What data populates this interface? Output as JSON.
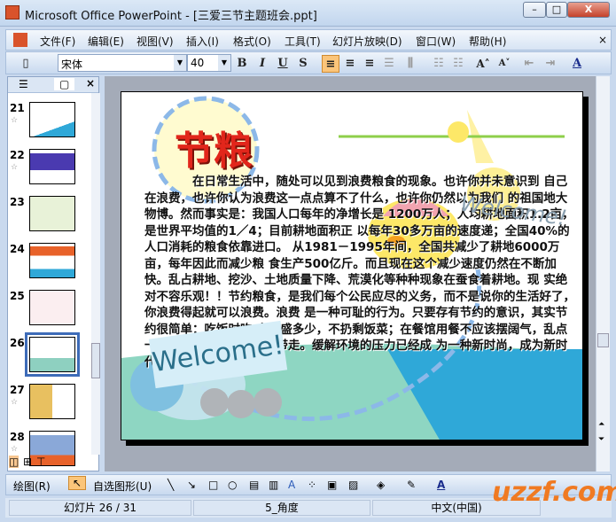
{
  "window": {
    "title": "Microsoft Office PowerPoint - [三爱三节主题班会.ppt]",
    "minimize": "–",
    "maximize": "□",
    "close": "X"
  },
  "menu": {
    "items": [
      "文件(F)",
      "编辑(E)",
      "视图(V)",
      "插入(I)",
      "格式(O)",
      "工具(T)",
      "幻灯片放映(D)",
      "窗口(W)",
      "帮助(H)"
    ],
    "close": "×"
  },
  "toolbar": {
    "font": "宋体",
    "size": "40",
    "bold": "B",
    "italic": "I",
    "underline": "U",
    "shadow": "S",
    "increase_font": "A˄",
    "decrease_font": "A˅",
    "font_color": "A"
  },
  "thumbnails": [
    {
      "num": "21"
    },
    {
      "num": "22"
    },
    {
      "num": "23"
    },
    {
      "num": "24"
    },
    {
      "num": "25"
    },
    {
      "num": "26",
      "selected": true
    },
    {
      "num": "27"
    },
    {
      "num": "28"
    }
  ],
  "slide": {
    "title": "节粮",
    "welcome1": "Welcome!",
    "welcome2": "Welcome!",
    "body": "在日常生活中，随处可以见到浪费粮食的现象。也许你并未意识到 自己在浪费，也许你认为浪费这一点点算不了什么，也许你仍然以为我们 的祖国地大物博。然而事实是：我国人口每年的净增长是 1200万人；人均耕地面积1.2亩，是世界平均值的1／4；目前耕地面积正 以每年30多万亩的速度递；全国40%的人口消耗的粮食依靠进口。 从1981－1995年间，全国共减少了耕地6000万亩，每年因此而减少粮 食生产500亿斤。而且现在这个减少速度仍然在不断加快。乱占耕地、挖沙、土地质量下降、荒漠化等种种现象在蚕食着耕地。现 实绝对不容乐观！！节约粮食，是我们每个公民应尽的义务，而不是说你的生活好了，你浪费得起就可以浪费。浪费 是一种可耻的行为。只要存有节约的意识，其实节约很简单：吃饭时吃 多少盛多少，不扔剩饭菜；在餐馆用餐不应该摆阔气，乱点一气。吃不完的饭菜打包带走。缓解环境的压力已经成 为一种新时尚，成为新时代人的……"
  },
  "drawing": {
    "draw": "绘图(R)",
    "autoshapes": "自选图形(U)"
  },
  "status": {
    "slide": "幻灯片 26 / 31",
    "design": "5_角度",
    "language": "中文(中国)"
  },
  "watermark": "uzzf.com",
  "colors": {
    "title": "#e2261b",
    "orange": "#f07a22",
    "blue": "#2fa8d8"
  }
}
